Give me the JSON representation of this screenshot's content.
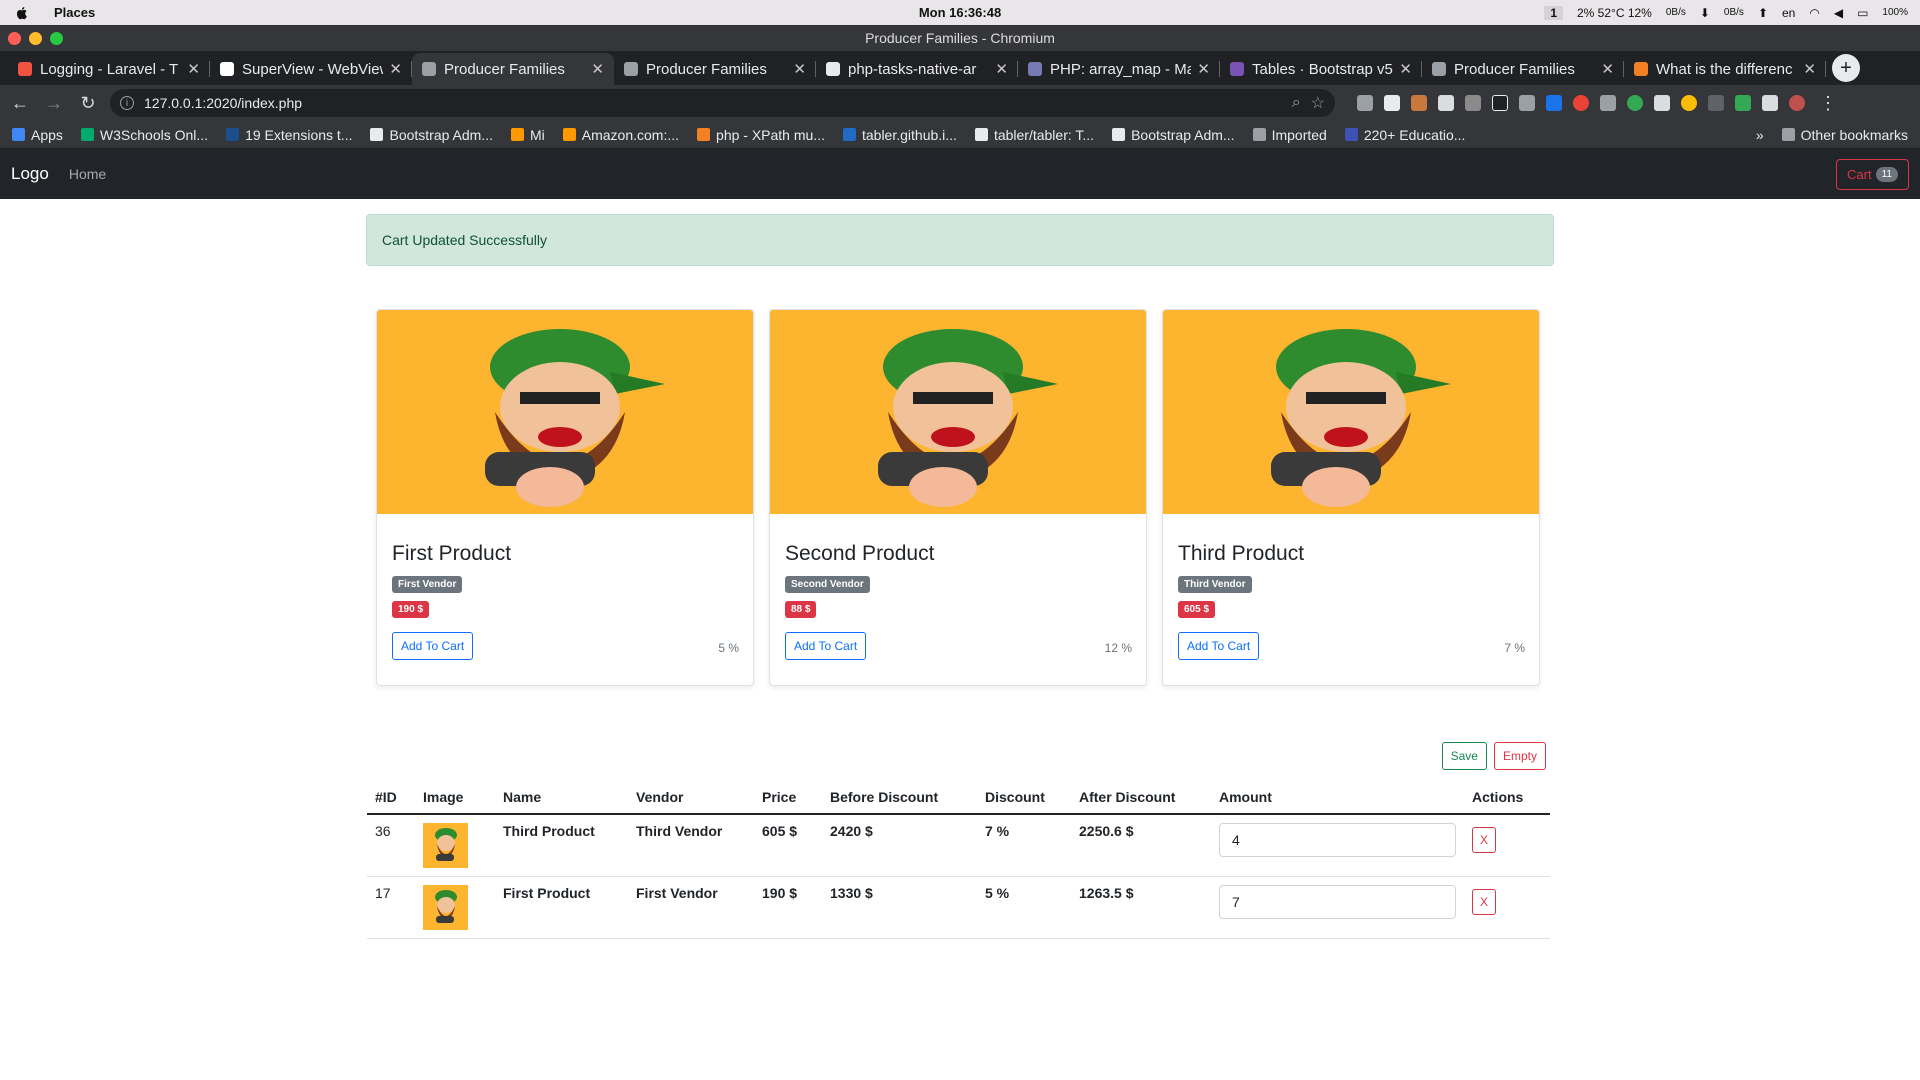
{
  "mac": {
    "app": "Places",
    "clock": "Mon 16:36:48",
    "workspace": "1",
    "stats": "2% 52°C 12%",
    "net_down": "0B/s",
    "net_up": "0B/s",
    "lang": "en",
    "battery": "100%"
  },
  "window": {
    "title": "Producer Families - Chromium"
  },
  "tabs": [
    {
      "title": "Logging - Laravel - T",
      "color": "#f05340"
    },
    {
      "title": "SuperView - WebView",
      "color": "#ffffff"
    },
    {
      "title": "Producer Families",
      "color": "#9aa0a6",
      "active": true
    },
    {
      "title": "Producer Families",
      "color": "#9aa0a6"
    },
    {
      "title": "php-tasks-native-ar",
      "color": "#e8eaed"
    },
    {
      "title": "PHP: array_map - Ma",
      "color": "#777bb3"
    },
    {
      "title": "Tables · Bootstrap v5",
      "color": "#7952b3"
    },
    {
      "title": "Producer Families",
      "color": "#9aa0a6"
    },
    {
      "title": "What is the differenc",
      "color": "#f48024"
    }
  ],
  "address": {
    "url": "127.0.0.1:2020/index.php"
  },
  "bookmarks": [
    {
      "label": "Apps",
      "color": "#4285f4"
    },
    {
      "label": "W3Schools Onl...",
      "color": "#04aa6d"
    },
    {
      "label": "19 Extensions t...",
      "color": "#1a4f8b"
    },
    {
      "label": "Bootstrap Adm...",
      "color": "#e8eaed"
    },
    {
      "label": "Mi",
      "color": "#ff9900"
    },
    {
      "label": "Amazon.com:...",
      "color": "#ff9900"
    },
    {
      "label": "php - XPath mu...",
      "color": "#f48024"
    },
    {
      "label": "tabler.github.i...",
      "color": "#206bc4"
    },
    {
      "label": "tabler/tabler: T...",
      "color": "#e8eaed"
    },
    {
      "label": "Bootstrap Adm...",
      "color": "#e8eaed"
    },
    {
      "label": "Imported",
      "color": "#9aa0a6"
    },
    {
      "label": "220+ Educatio...",
      "color": "#3f51b5"
    }
  ],
  "bookmarks_other": "Other bookmarks",
  "navbar": {
    "brand": "Logo",
    "home": "Home",
    "cart_label": "Cart",
    "cart_count": "11"
  },
  "alert": "Cart Updated Successfully",
  "products": [
    {
      "name": "First Product",
      "vendor": "First Vendor",
      "price": "190 $",
      "button": "Add To Cart",
      "discount": "5 %"
    },
    {
      "name": "Second Product",
      "vendor": "Second Vendor",
      "price": "88 $",
      "button": "Add To Cart",
      "discount": "12 %"
    },
    {
      "name": "Third Product",
      "vendor": "Third Vendor",
      "price": "605 $",
      "button": "Add To Cart",
      "discount": "7 %"
    }
  ],
  "cart_actions": {
    "save": "Save",
    "empty": "Empty"
  },
  "cart_table": {
    "headers": [
      "#ID",
      "Image",
      "Name",
      "Vendor",
      "Price",
      "Before Discount",
      "Discount",
      "After Discount",
      "Amount",
      "Actions"
    ],
    "rows": [
      {
        "id": "36",
        "name": "Third Product",
        "vendor": "Third Vendor",
        "price": "605 $",
        "before": "2420 $",
        "discount": "7 %",
        "after": "2250.6 $",
        "amount": "4",
        "remove": "X"
      },
      {
        "id": "17",
        "name": "First Product",
        "vendor": "First Vendor",
        "price": "190 $",
        "before": "1330 $",
        "discount": "5 %",
        "after": "1263.5 $",
        "amount": "7",
        "remove": "X"
      }
    ]
  },
  "colors": {
    "image_bg": "#fdb42f",
    "navbar_bg": "#212529",
    "alert_bg": "#d1e7dd",
    "danger": "#dc3545",
    "primary": "#0d6efd",
    "success": "#198754"
  }
}
